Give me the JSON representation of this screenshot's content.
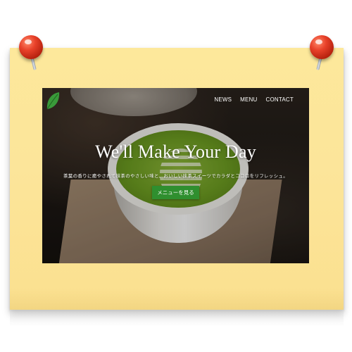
{
  "site": {
    "nav": [
      "NEWS",
      "MENU",
      "CONTACT"
    ],
    "hero_title": "We'll Make Your Day",
    "hero_subtitle": "茶葉の香りに癒やされて抹茶のやさしい味と、おいしい抹茶スイーツでカラダとココロをリフレッシュ。",
    "menu_button": "メニューを見る",
    "logo_icon": "leaf-icon"
  },
  "colors": {
    "note": "#fce59a",
    "pin": "#e8412a",
    "button": "#2f8f2f",
    "logo": "#3a9a3a"
  }
}
